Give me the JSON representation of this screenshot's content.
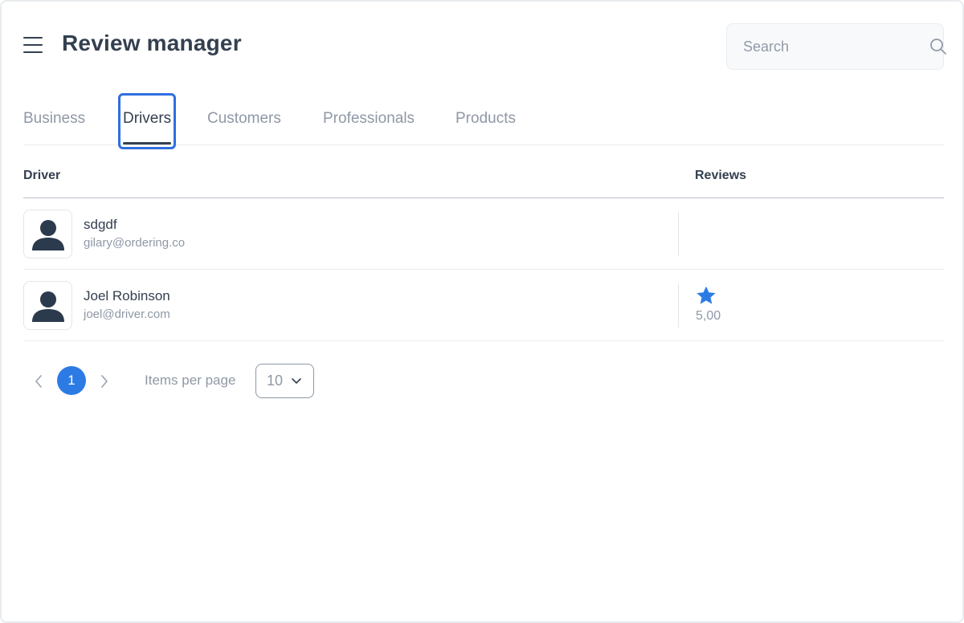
{
  "header": {
    "title": "Review manager",
    "search_placeholder": "Search"
  },
  "tabs": [
    {
      "label": "Business",
      "active": false
    },
    {
      "label": "Drivers",
      "active": true
    },
    {
      "label": "Customers",
      "active": false
    },
    {
      "label": "Professionals",
      "active": false
    },
    {
      "label": "Products",
      "active": false
    }
  ],
  "table": {
    "columns": [
      "Driver",
      "Reviews"
    ],
    "rows": [
      {
        "name": "sdgdf",
        "email": "gilary@ordering.co",
        "rating": null
      },
      {
        "name": "Joel Robinson",
        "email": "joel@driver.com",
        "rating": "5,00"
      }
    ]
  },
  "pagination": {
    "current_page": "1",
    "items_per_page_label": "Items per page",
    "items_per_page": "10"
  },
  "colors": {
    "accent": "#2c7be5",
    "active_tab_outline": "#2f6fdf",
    "text_primary": "#344050",
    "text_muted": "#8f98a6"
  },
  "icons": [
    "menu-icon",
    "search-icon",
    "user-avatar-icon",
    "star-icon",
    "chevron-left-icon",
    "chevron-right-icon",
    "chevron-down-icon"
  ]
}
